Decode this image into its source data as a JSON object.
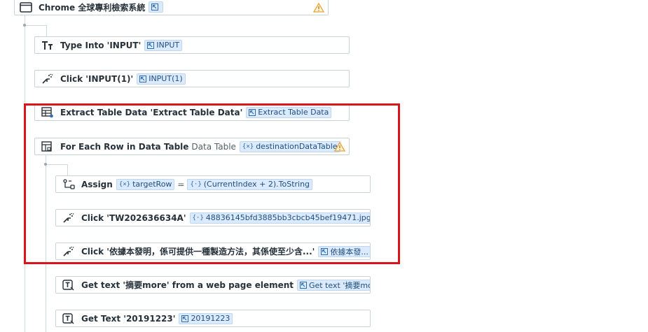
{
  "colors": {
    "accent": "#1f4f80",
    "chip_bg": "#dbeafe",
    "warning": "#e8a33c",
    "selection": "#d9141a",
    "border": "#c9d2d8"
  },
  "scope": {
    "title": "Chrome 全球專利檢索系統",
    "icon": "browser-window-icon",
    "has_warning": true
  },
  "activities": [
    {
      "name": "type-into-input",
      "icon": "type-into-icon",
      "title": "Type Into 'INPUT'",
      "chip": "INPUT",
      "chip_type": "element"
    },
    {
      "name": "click-input-1",
      "icon": "click-icon",
      "title": "Click 'INPUT(1)'",
      "chip": "INPUT(1)",
      "chip_type": "element"
    },
    {
      "name": "extract-table-data",
      "icon": "extract-table-icon",
      "title": "Extract Table Data 'Extract Table Data'",
      "chip": "Extract Table Data",
      "chip_type": "element"
    }
  ],
  "foreach": {
    "title": "For Each Row in Data Table",
    "label": "Data Table",
    "chip": "destinationDataTable",
    "has_warning": true
  },
  "inner": [
    {
      "name": "assign",
      "icon": "assign-icon",
      "title": "Assign",
      "chip": "targetRow",
      "chip_type": "variable",
      "eq": "=",
      "chip2": "(CurrentIndex + 2).ToString",
      "chip2_type": "expression"
    },
    {
      "name": "click-tw-image",
      "icon": "click-icon",
      "title": "Click 'TW202636634A'",
      "chip": "48836145bfd3885bb3cbcb45bef19471.jpg",
      "chip_type": "expression"
    },
    {
      "name": "click-description",
      "icon": "click-icon",
      "title": "Click '依據本發明，係可提供一種製造方法，其係使至少含...'",
      "chip": "依據本發...",
      "chip_type": "element"
    },
    {
      "name": "get-text-more",
      "icon": "get-text-icon",
      "title": "Get text '摘要more' from a web page element",
      "chip": "Get text '摘要more'...",
      "chip_type": "element"
    },
    {
      "name": "get-text-date",
      "icon": "get-text-icon",
      "title": "Get Text '20191223'",
      "chip": "20191223",
      "chip_type": "element"
    }
  ]
}
